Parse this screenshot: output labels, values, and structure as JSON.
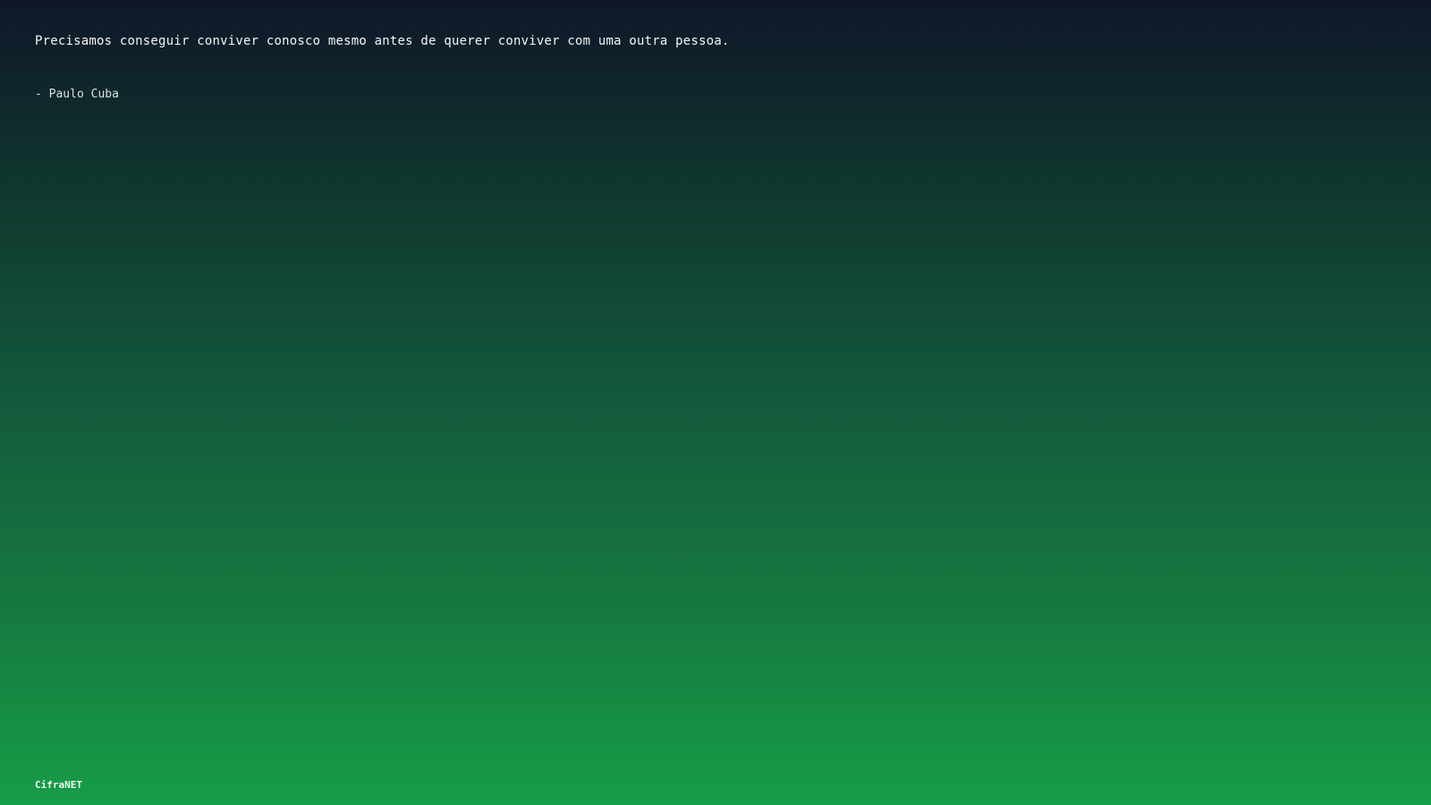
{
  "quote": {
    "text": "Precisamos conseguir conviver conosco mesmo antes de querer conviver com uma outra pessoa.",
    "author": "- Paulo Cuba"
  },
  "footer": {
    "brand": "CifraNET"
  },
  "colors": {
    "background_top": "#0f1729",
    "background_bottom": "#169d48",
    "text": "#f2f5f3"
  }
}
